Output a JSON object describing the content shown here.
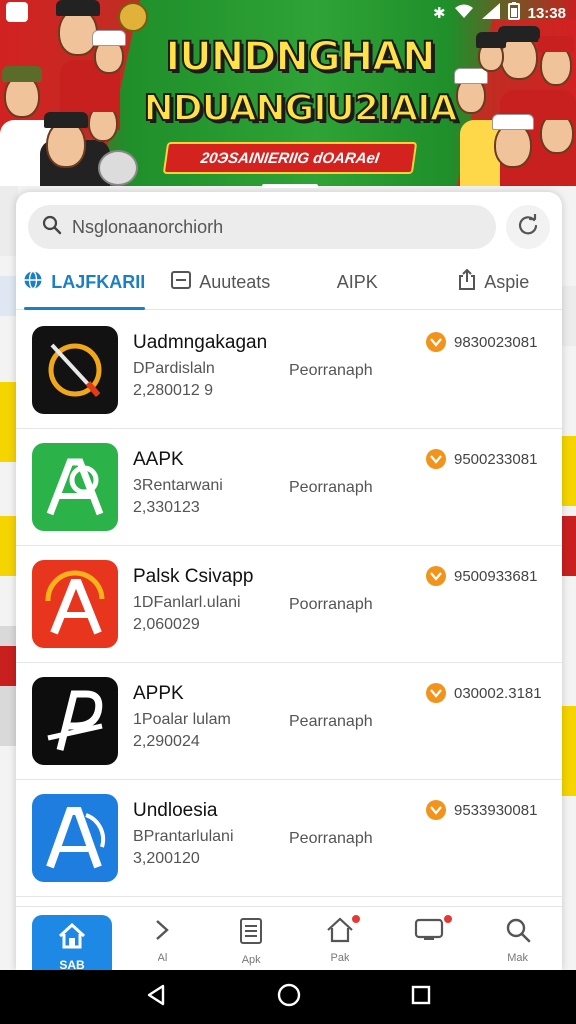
{
  "status_bar": {
    "time": "13:38"
  },
  "banner": {
    "title_line1": "IUNDNGHAN",
    "title_line2": "NDUANGIU2IAIA",
    "ribbon": "20ЭSAINIERIIG dOARAeI"
  },
  "search": {
    "value": "Nsglonaanorchiorh",
    "placeholder": "Nsglonaanorchiorh"
  },
  "tabs": [
    {
      "label": "LAJFKARII",
      "icon": "globe-icon",
      "active": true
    },
    {
      "label": "Auuteats",
      "icon": "app-window-icon",
      "active": false
    },
    {
      "label": "AIPK",
      "icon": "",
      "active": false
    },
    {
      "label": "Aspie",
      "icon": "share-icon",
      "active": false
    }
  ],
  "apps": [
    {
      "name": "Uadmngakagan",
      "sub1": "DPardislaln",
      "sub2": "2,280012 9",
      "developer": "Peorranaph",
      "size": "9830023081"
    },
    {
      "name": "AAPK",
      "sub1": "3Rentarwani",
      "sub2": "2,330123",
      "developer": "Peorranaph",
      "size": "9500233081"
    },
    {
      "name": "Palsk Csivapp",
      "sub1": "1DFanlarl.ulani",
      "sub2": "2,060029",
      "developer": "Poorranaph",
      "size": "9500933681"
    },
    {
      "name": "APPK",
      "sub1": "1Poalar lulam",
      "sub2": "2,290024",
      "developer": "Pearranaph",
      "size": "030002.3181"
    },
    {
      "name": "Undloesia",
      "sub1": "BPrantarlulani",
      "sub2": "3,200120",
      "developer": "Peorranaph",
      "size": "9533930081"
    }
  ],
  "bottom_nav": [
    {
      "label": "SAB",
      "icon": "home-icon"
    },
    {
      "label": "Al",
      "icon": "chevron-right-icon"
    },
    {
      "label": "Apk",
      "icon": "list-document-icon"
    },
    {
      "label": "Pak",
      "icon": "house-outline-icon"
    },
    {
      "label": "",
      "icon": "tv-icon"
    },
    {
      "label": "Mak",
      "icon": "search-icon"
    }
  ],
  "colors": {
    "accent": "#1a7fc4",
    "download": "#f2941c",
    "nav_active": "#1e88e5",
    "badge": "#e53935"
  }
}
